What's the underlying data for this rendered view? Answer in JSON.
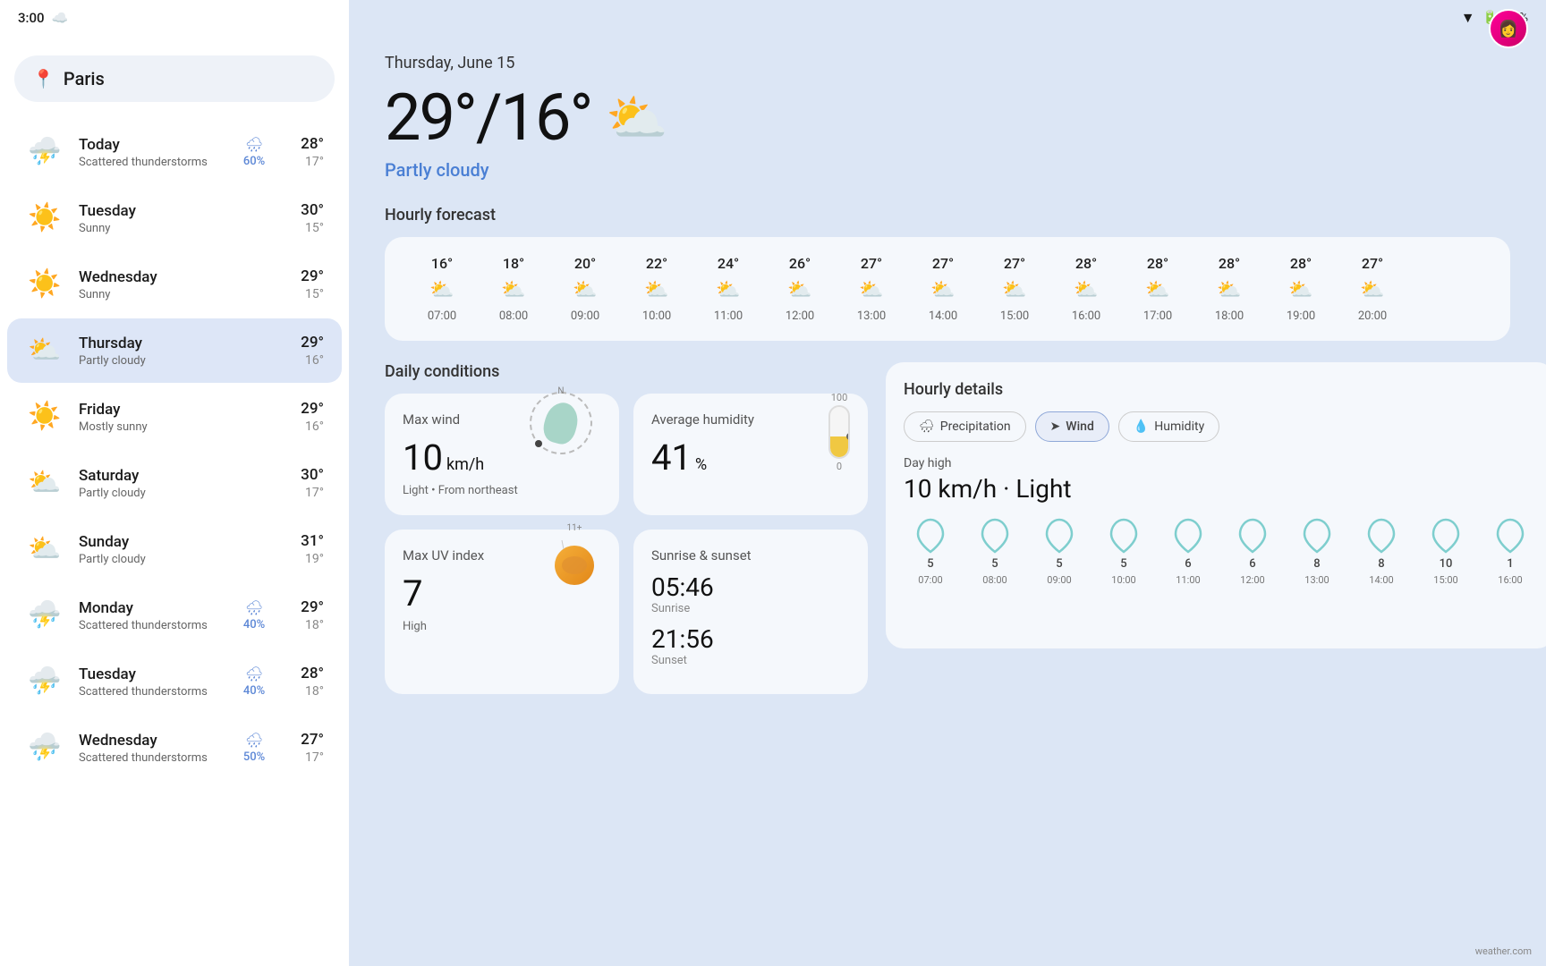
{
  "status": {
    "time": "3:00",
    "battery": "73%"
  },
  "location": {
    "name": "Paris",
    "pin_icon": "📍"
  },
  "current": {
    "date": "Thursday, June 15",
    "temp_high": "29°",
    "temp_low": "16°",
    "condition": "Partly cloudy",
    "temp_display": "29°/16°"
  },
  "hourly": {
    "title": "Hourly forecast",
    "items": [
      {
        "time": "07:00",
        "temp": "16°",
        "icon": "partly_cloudy"
      },
      {
        "time": "08:00",
        "temp": "18°",
        "icon": "partly_cloudy"
      },
      {
        "time": "09:00",
        "temp": "20°",
        "icon": "partly_cloudy"
      },
      {
        "time": "10:00",
        "temp": "22°",
        "icon": "partly_cloudy"
      },
      {
        "time": "11:00",
        "temp": "24°",
        "icon": "partly_cloudy"
      },
      {
        "time": "12:00",
        "temp": "26°",
        "icon": "partly_cloudy"
      },
      {
        "time": "13:00",
        "temp": "27°",
        "icon": "partly_cloudy"
      },
      {
        "time": "14:00",
        "temp": "27°",
        "icon": "partly_cloudy"
      },
      {
        "time": "15:00",
        "temp": "27°",
        "icon": "partly_cloudy"
      },
      {
        "time": "16:00",
        "temp": "28°",
        "icon": "partly_cloudy"
      },
      {
        "time": "17:00",
        "temp": "28°",
        "icon": "partly_cloudy"
      },
      {
        "time": "18:00",
        "temp": "28°",
        "icon": "partly_cloudy"
      },
      {
        "time": "19:00",
        "temp": "28°",
        "icon": "partly_cloudy"
      },
      {
        "time": "20:00",
        "temp": "27°",
        "icon": "partly_cloudy"
      }
    ]
  },
  "daily_conditions": {
    "title": "Daily conditions",
    "wind": {
      "label": "Max wind",
      "value": "10",
      "unit": "km/h",
      "desc": "Light • From northeast"
    },
    "humidity": {
      "label": "Average humidity",
      "value": "41",
      "unit": "%",
      "max": "100",
      "min": "0"
    },
    "uv": {
      "label": "Max UV index",
      "value": "7",
      "level": "High",
      "max": "11+"
    },
    "sun": {
      "label": "Sunrise & sunset",
      "sunrise": "05:46",
      "sunrise_label": "Sunrise",
      "sunset": "21:56",
      "sunset_label": "Sunset"
    }
  },
  "hourly_details": {
    "title": "Hourly details",
    "tabs": [
      "Precipitation",
      "Wind",
      "Humidity"
    ],
    "active_tab": "Wind",
    "day_high_label": "Day high",
    "day_high_value": "10 km/h · Light",
    "wind_chart": [
      {
        "time": "07:00",
        "val": "5"
      },
      {
        "time": "08:00",
        "val": "5"
      },
      {
        "time": "09:00",
        "val": "5"
      },
      {
        "time": "10:00",
        "val": "5"
      },
      {
        "time": "11:00",
        "val": "6"
      },
      {
        "time": "12:00",
        "val": "6"
      },
      {
        "time": "13:00",
        "val": "8"
      },
      {
        "time": "14:00",
        "val": "8"
      },
      {
        "time": "15:00",
        "val": "10"
      },
      {
        "time": "16:00",
        "val": "1"
      }
    ]
  },
  "forecast": {
    "days": [
      {
        "name": "Today",
        "desc": "Scattered thunderstorms",
        "icon": "thunder",
        "precip": "60%",
        "high": "28°",
        "low": "17°",
        "has_precip": true
      },
      {
        "name": "Tuesday",
        "desc": "Sunny",
        "icon": "sun",
        "precip": "",
        "high": "30°",
        "low": "15°",
        "has_precip": false
      },
      {
        "name": "Wednesday",
        "desc": "Sunny",
        "icon": "sun",
        "precip": "",
        "high": "29°",
        "low": "15°",
        "has_precip": false
      },
      {
        "name": "Thursday",
        "desc": "Partly cloudy",
        "icon": "partly_cloudy",
        "precip": "",
        "high": "29°",
        "low": "16°",
        "has_precip": false,
        "active": true
      },
      {
        "name": "Friday",
        "desc": "Mostly sunny",
        "icon": "sun",
        "precip": "",
        "high": "29°",
        "low": "16°",
        "has_precip": false
      },
      {
        "name": "Saturday",
        "desc": "Partly cloudy",
        "icon": "partly_cloudy",
        "precip": "",
        "high": "30°",
        "low": "17°",
        "has_precip": false
      },
      {
        "name": "Sunday",
        "desc": "Partly cloudy",
        "icon": "partly_cloudy",
        "precip": "",
        "high": "31°",
        "low": "19°",
        "has_precip": false
      },
      {
        "name": "Monday",
        "desc": "Scattered thunderstorms",
        "icon": "thunder",
        "precip": "40%",
        "high": "29°",
        "low": "18°",
        "has_precip": true
      },
      {
        "name": "Tuesday",
        "desc": "Scattered thunderstorms",
        "icon": "thunder",
        "precip": "40%",
        "high": "28°",
        "low": "18°",
        "has_precip": true
      },
      {
        "name": "Wednesday",
        "desc": "Scattered thunderstorms",
        "icon": "thunder",
        "precip": "50%",
        "high": "27°",
        "low": "17°",
        "has_precip": true
      }
    ]
  },
  "attribution": "weather.com"
}
